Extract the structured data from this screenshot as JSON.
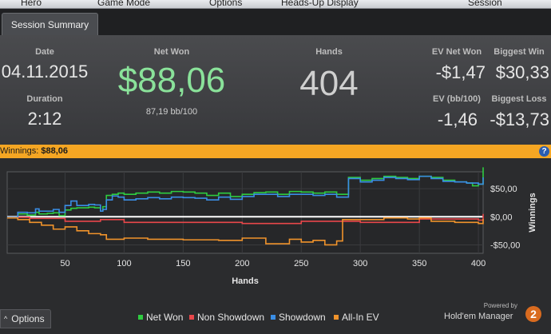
{
  "menu": [
    "Hero",
    "Game Mode",
    "Options",
    "Heads-Up Display",
    "Session"
  ],
  "tab": "Session Summary",
  "summary": {
    "date_label": "Date",
    "date": "04.11.2015",
    "duration_label": "Duration",
    "duration": "2:12",
    "netwon_label": "Net Won",
    "netwon": "$88,06",
    "bb": "87,19 bb/100",
    "hands_label": "Hands",
    "hands": "404",
    "ev_net_label": "EV Net Won",
    "ev_net": "-$1,47",
    "ev_bb_label": "EV (bb/100)",
    "ev_bb": "-1,46",
    "big_win_label": "Biggest Win",
    "big_win": "$30,33",
    "big_loss_label": "Biggest Loss",
    "big_loss": "-$13,73"
  },
  "winnings_bar": {
    "label": "Winnings:",
    "value": "$88,06"
  },
  "colors": {
    "net_won": "#2ecc40",
    "non_showdown": "#e8474a",
    "showdown": "#3a8ee6",
    "allin_ev": "#f0932b",
    "accent": "#f5a623"
  },
  "chart_data": {
    "type": "line",
    "xlabel": "Hands",
    "ylabel": "Winnings",
    "xlim": [
      1,
      404
    ],
    "ylim": [
      -65,
      80
    ],
    "x_ticks": [
      "50",
      "100",
      "150",
      "200",
      "250",
      "300",
      "350",
      "400"
    ],
    "x_tick_values": [
      50,
      100,
      150,
      200,
      250,
      300,
      350,
      400
    ],
    "y_ticks": [
      "$50,00",
      "$0,00",
      "-$50,00"
    ],
    "y_tick_values": [
      50,
      0,
      -50
    ],
    "grid": true,
    "series": [
      {
        "name": "Net Won",
        "color": "#2ecc40",
        "x": [
          1,
          10,
          18,
          25,
          28,
          35,
          40,
          45,
          50,
          55,
          60,
          70,
          75,
          80,
          82,
          85,
          90,
          95,
          100,
          110,
          120,
          130,
          140,
          150,
          160,
          170,
          180,
          190,
          200,
          210,
          220,
          230,
          240,
          250,
          260,
          270,
          280,
          290,
          300,
          310,
          320,
          330,
          340,
          350,
          360,
          370,
          380,
          390,
          395,
          400,
          404
        ],
        "y": [
          -2,
          5,
          3,
          8,
          5,
          6,
          7,
          2,
          12,
          15,
          16,
          17,
          16,
          10,
          18,
          38,
          40,
          42,
          40,
          42,
          44,
          42,
          45,
          44,
          42,
          38,
          42,
          36,
          40,
          43,
          44,
          40,
          45,
          44,
          42,
          44,
          40,
          70,
          65,
          68,
          72,
          70,
          68,
          72,
          70,
          65,
          62,
          60,
          55,
          58,
          88
        ]
      },
      {
        "name": "Non Showdown",
        "color": "#e8474a",
        "x": [
          1,
          20,
          50,
          80,
          100,
          150,
          200,
          250,
          300,
          350,
          400,
          404
        ],
        "y": [
          -1,
          -3,
          -8,
          -5,
          -10,
          -10,
          -12,
          -8,
          -10,
          -4,
          -6,
          5
        ]
      },
      {
        "name": "Showdown",
        "color": "#3a8ee6",
        "x": [
          1,
          10,
          18,
          25,
          28,
          35,
          40,
          45,
          50,
          55,
          60,
          70,
          75,
          80,
          82,
          85,
          90,
          95,
          100,
          110,
          120,
          130,
          140,
          150,
          160,
          170,
          180,
          190,
          200,
          210,
          220,
          230,
          240,
          250,
          260,
          270,
          280,
          290,
          300,
          310,
          320,
          330,
          340,
          350,
          360,
          370,
          380,
          390,
          400,
          404
        ],
        "y": [
          -1,
          8,
          7,
          14,
          10,
          10,
          13,
          8,
          20,
          28,
          20,
          22,
          21,
          10,
          13,
          30,
          37,
          35,
          30,
          32,
          34,
          32,
          35,
          34,
          33,
          30,
          35,
          31,
          36,
          40,
          40,
          36,
          40,
          40,
          38,
          40,
          35,
          68,
          62,
          65,
          70,
          68,
          66,
          72,
          68,
          63,
          62,
          60,
          58,
          70
        ]
      },
      {
        "name": "All-In EV",
        "color": "#f0932b",
        "x": [
          1,
          10,
          20,
          30,
          40,
          50,
          60,
          70,
          80,
          85,
          100,
          120,
          150,
          180,
          200,
          220,
          240,
          250,
          260,
          270,
          280,
          285,
          300,
          320,
          340,
          350,
          360,
          380,
          400,
          404
        ],
        "y": [
          -2,
          -5,
          -10,
          -15,
          -22,
          -18,
          -25,
          -30,
          -32,
          -40,
          -38,
          -40,
          -41,
          -42,
          -38,
          -48,
          -40,
          -45,
          -42,
          -50,
          -43,
          -5,
          -5,
          -2,
          -4,
          -2,
          -8,
          -10,
          -12,
          -4
        ]
      }
    ]
  },
  "legend": [
    "Net Won",
    "Non Showdown",
    "Showdown",
    "All-In EV"
  ],
  "options_label": "Options",
  "logo": {
    "powered": "Powered by",
    "name": "Hold'em Manager",
    "badge": "2"
  }
}
